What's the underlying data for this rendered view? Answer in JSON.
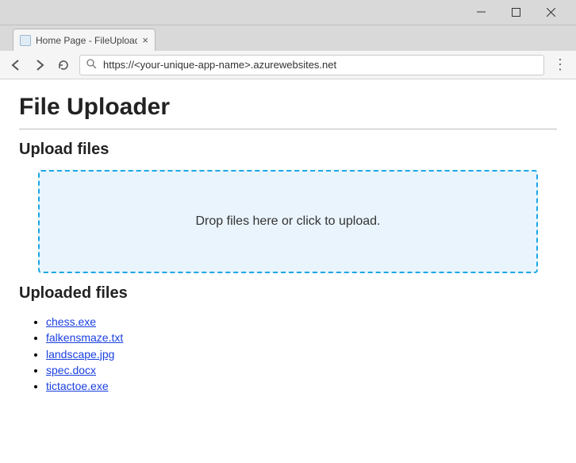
{
  "window": {
    "tab_title": "Home Page - FileUploade"
  },
  "nav": {
    "url": "https://<your-unique-app-name>.azurewebsites.net"
  },
  "page": {
    "heading": "File Uploader",
    "upload_heading": "Upload files",
    "dropzone_text": "Drop files here or click to upload.",
    "uploaded_heading": "Uploaded files"
  },
  "files": {
    "items": [
      "chess.exe",
      "falkensmaze.txt",
      "landscape.jpg",
      "spec.docx",
      "tictactoe.exe"
    ],
    "f0": "chess.exe",
    "f1": "falkensmaze.txt",
    "f2": "landscape.jpg",
    "f3": "spec.docx",
    "f4": "tictactoe.exe"
  }
}
